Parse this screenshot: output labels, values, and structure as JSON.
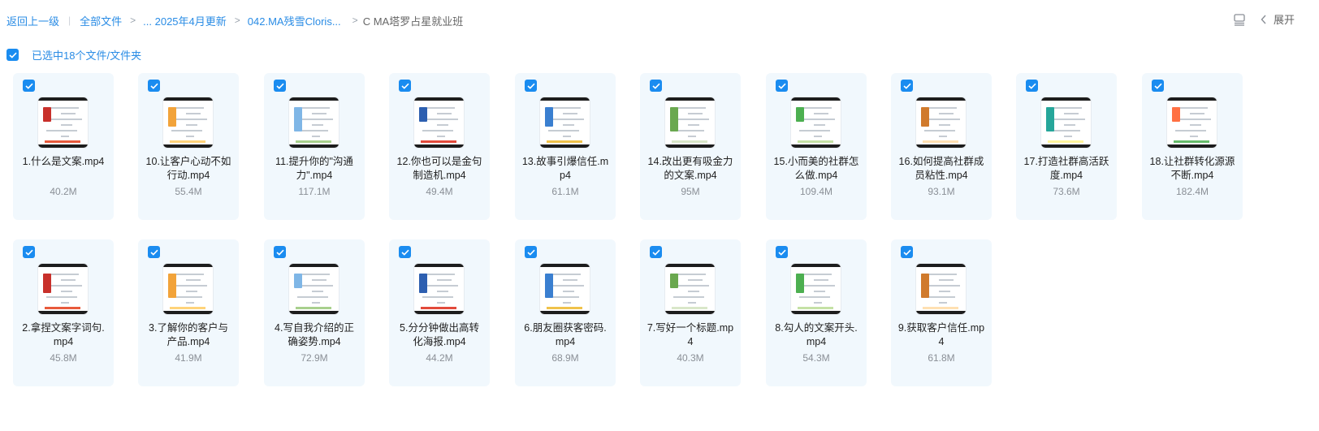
{
  "breadcrumb": {
    "back_label": "返回上一级",
    "divider": "|",
    "items": [
      "全部文件",
      "... 2025年4月更新",
      "042.MA残雪Cloris..."
    ],
    "separator": ">",
    "current": "C MA塔罗占星就业班"
  },
  "toolbar": {
    "view_icon": "list-view-icon",
    "expand_label": "展开"
  },
  "selection": {
    "checked": true,
    "label": "已选中18个文件/文件夹"
  },
  "accent_color": "#1a8cf0",
  "files": [
    {
      "name": "1.什么是文案.mp4",
      "size": "40.2M",
      "checked": true
    },
    {
      "name": "10.让客户心动不如行动.mp4",
      "size": "55.4M",
      "checked": true
    },
    {
      "name": "11.提升你的\"沟通力\".mp4",
      "size": "117.1M",
      "checked": true
    },
    {
      "name": "12.你也可以是金句制造机.mp4",
      "size": "49.4M",
      "checked": true
    },
    {
      "name": "13.故事引爆信任.mp4",
      "size": "61.1M",
      "checked": true
    },
    {
      "name": "14.改出更有吸金力的文案.mp4",
      "size": "95M",
      "checked": true
    },
    {
      "name": "15.小而美的社群怎么做.mp4",
      "size": "109.4M",
      "checked": true
    },
    {
      "name": "16.如何提高社群成员粘性.mp4",
      "size": "93.1M",
      "checked": true
    },
    {
      "name": "17.打造社群高活跃度.mp4",
      "size": "73.6M",
      "checked": true
    },
    {
      "name": "18.让社群转化源源不断.mp4",
      "size": "182.4M",
      "checked": true
    },
    {
      "name": "2.拿捏文案字词句.mp4",
      "size": "45.8M",
      "checked": true
    },
    {
      "name": "3.了解你的客户与产品.mp4",
      "size": "41.9M",
      "checked": true
    },
    {
      "name": "4.写自我介绍的正确姿势.mp4",
      "size": "72.9M",
      "checked": true
    },
    {
      "name": "5.分分钟做出高转化海报.mp4",
      "size": "44.2M",
      "checked": true
    },
    {
      "name": "6.朋友圈获客密码.mp4",
      "size": "68.9M",
      "checked": true
    },
    {
      "name": "7.写好一个标题.mp4",
      "size": "40.3M",
      "checked": true
    },
    {
      "name": "8.勾人的文案开头.mp4",
      "size": "54.3M",
      "checked": true
    },
    {
      "name": "9.获取客户信任.mp4",
      "size": "61.8M",
      "checked": true
    }
  ]
}
